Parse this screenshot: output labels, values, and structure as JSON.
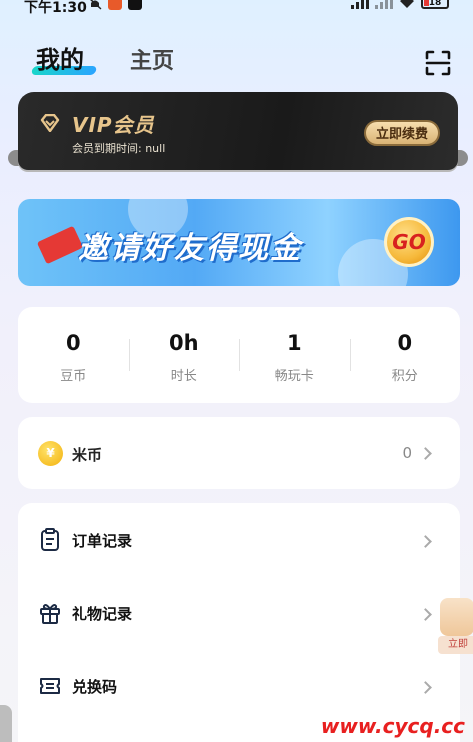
{
  "status_bar": {
    "time": "下午1:30",
    "battery": "18"
  },
  "header": {
    "tabs": [
      {
        "label": "我的",
        "active": true
      },
      {
        "label": "主页",
        "active": false
      }
    ],
    "scan_icon": "scan-icon"
  },
  "vip": {
    "title": "VIP会员",
    "subtitle": "会员到期时间: null",
    "renew_label": "立即续费"
  },
  "invite_banner": {
    "text": "邀请好友得现金",
    "go_label": "GO"
  },
  "stats": [
    {
      "value": "0",
      "label": "豆币"
    },
    {
      "value": "0h",
      "label": "时长"
    },
    {
      "value": "1",
      "label": "畅玩卡"
    },
    {
      "value": "0",
      "label": "积分"
    }
  ],
  "coin": {
    "name": "米币",
    "amount": "0",
    "icon_glyph": "¥"
  },
  "menu": [
    {
      "label": "订单记录",
      "icon": "order-icon"
    },
    {
      "label": "礼物记录",
      "icon": "gift-icon"
    },
    {
      "label": "兑换码",
      "icon": "ticket-icon"
    }
  ],
  "float_badge": {
    "label": "立即"
  },
  "watermark": "www.cycq.cc",
  "colors": {
    "vip_gold": "#e7c58c",
    "vip_bg": "#1a1a1a",
    "banner_blue": "#53a9f5",
    "go_red": "#d8211f",
    "coin_yellow": "#f3b10d"
  }
}
